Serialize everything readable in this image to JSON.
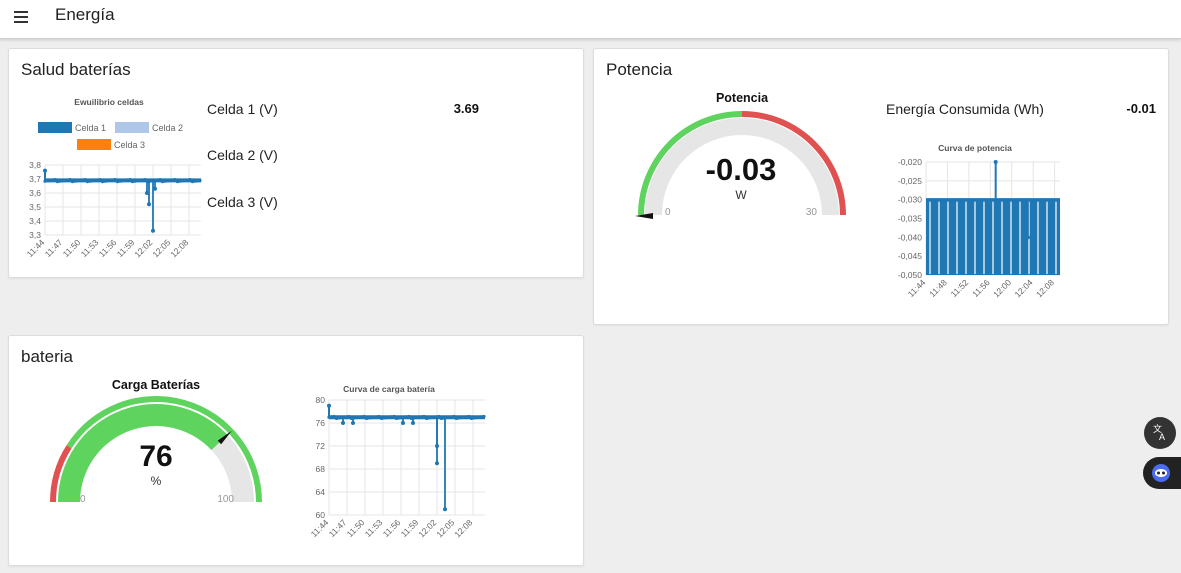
{
  "header": {
    "title": "Energía",
    "menu_icon": "hamburger-menu-icon"
  },
  "cards": {
    "salud": {
      "title": "Salud baterías",
      "chart_title": "Ewuilibrio celdas",
      "legend": [
        {
          "name": "Celda 1",
          "color": "#1f77b4"
        },
        {
          "name": "Celda 2",
          "color": "#aec7e8"
        },
        {
          "name": "Celda 3",
          "color": "#ff7f0e"
        }
      ],
      "readings": [
        {
          "label": "Celda 1 (V)",
          "value": "3.69"
        },
        {
          "label": "Celda 2 (V)",
          "value": ""
        },
        {
          "label": "Celda 3 (V)",
          "value": ""
        }
      ]
    },
    "potencia": {
      "title": "Potencia",
      "gauge_title": "Potencia",
      "gauge_value": "-0.03",
      "gauge_unit": "W",
      "gauge_min": "0",
      "gauge_max": "30",
      "energy_label": "Energía Consumida (Wh)",
      "energy_value": "-0.01",
      "chart_title": "Curva de potencia"
    },
    "bateria": {
      "title": "bateria",
      "gauge_title": "Carga Baterías",
      "gauge_value": "76",
      "gauge_unit": "%",
      "gauge_min": "0",
      "gauge_max": "100",
      "chart_title": "Curva de carga batería"
    }
  },
  "colors": {
    "series": "#1f77b4",
    "gauge_green": "#5ed35e",
    "gauge_red": "#e05252",
    "gauge_track": "#e6e6e6"
  },
  "fabs": [
    {
      "icon": "translate-icon"
    },
    {
      "icon": "assistant-bot-icon"
    }
  ],
  "chart_data": [
    {
      "type": "line",
      "title": "Ewuilibrio celdas",
      "ylim": [
        3.3,
        3.8
      ],
      "y_ticks": [
        "3,8",
        "3,7",
        "3,6",
        "3,5",
        "3,4",
        "3,3"
      ],
      "x_ticks": [
        "11:44",
        "11:47",
        "11:50",
        "11:53",
        "11:56",
        "11:59",
        "12:02",
        "12:05",
        "12:08"
      ],
      "series": [
        {
          "name": "Celda 1",
          "baseline": 3.69,
          "x_range": [
            "11:44",
            "12:10"
          ],
          "dips": [
            {
              "x": "12:01",
              "y": 3.6
            },
            {
              "x": "12:01",
              "y": 3.52
            },
            {
              "x": "12:02",
              "y": 3.33
            },
            {
              "x": "12:02",
              "y": 3.63
            }
          ],
          "spikes": [
            {
              "x": "11:44",
              "y": 3.76
            }
          ]
        }
      ]
    },
    {
      "type": "bar",
      "title": "Curva de potencia",
      "ylim": [
        -0.05,
        -0.02
      ],
      "y_ticks": [
        "-0,020",
        "-0,025",
        "-0,030",
        "-0,035",
        "-0,040",
        "-0,045",
        "-0,050"
      ],
      "x_ticks": [
        "11:44",
        "11:48",
        "11:52",
        "11:56",
        "12:00",
        "12:04",
        "12:08"
      ],
      "series": [
        {
          "baseline": -0.03,
          "low": -0.05,
          "x_range": [
            "11:44",
            "12:09"
          ],
          "spikes": [
            {
              "x": "11:57",
              "y": -0.02
            },
            {
              "x": "12:03",
              "y": -0.04
            }
          ]
        }
      ]
    },
    {
      "type": "line",
      "title": "Curva de carga batería",
      "ylim": [
        60,
        80
      ],
      "y_ticks": [
        "80",
        "76",
        "72",
        "68",
        "64",
        "60"
      ],
      "x_ticks": [
        "11:44",
        "11:47",
        "11:50",
        "11:53",
        "11:56",
        "11:59",
        "12:02",
        "12:05",
        "12:08"
      ],
      "series": [
        {
          "baseline": 77,
          "x_range": [
            "11:44",
            "12:10"
          ],
          "dips": [
            {
              "x": "12:02",
              "y": 69
            },
            {
              "x": "12:03",
              "y": 61
            },
            {
              "x": "12:02",
              "y": 72
            },
            {
              "x": "11:46",
              "y": 76
            },
            {
              "x": "11:48",
              "y": 76
            },
            {
              "x": "11:56",
              "y": 76
            },
            {
              "x": "11:58",
              "y": 76
            }
          ],
          "spikes": [
            {
              "x": "11:44",
              "y": 79
            }
          ]
        }
      ]
    }
  ]
}
